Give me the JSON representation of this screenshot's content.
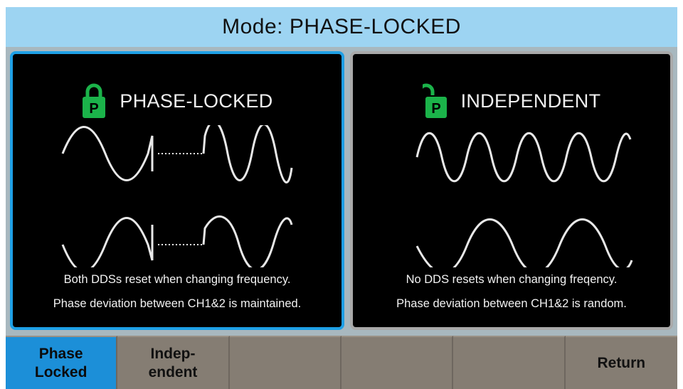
{
  "header": {
    "title": "Mode: PHASE-LOCKED"
  },
  "panels": {
    "left": {
      "title": "PHASE-LOCKED",
      "icon": "locked-padlock-icon",
      "line1": "Both DDSs reset when changing frequency.",
      "line2": "Phase deviation between CH1&2 is maintained."
    },
    "right": {
      "title": "INDEPENDENT",
      "icon": "unlocked-padlock-icon",
      "line1": "No DDS resets when changing freqency.",
      "line2": "Phase deviation between CH1&2 is random."
    }
  },
  "softkeys": [
    {
      "label": "Phase\nLocked",
      "active": true
    },
    {
      "label": "Indep-\nendent",
      "active": false
    },
    {
      "label": "",
      "active": false
    },
    {
      "label": "",
      "active": false
    },
    {
      "label": "",
      "active": false
    },
    {
      "label": "Return",
      "active": false
    }
  ],
  "colors": {
    "accent": "#1ea0e6",
    "title_bar": "#9dd4f2",
    "lock_green": "#1bb34a",
    "softkey": "#857d73"
  }
}
